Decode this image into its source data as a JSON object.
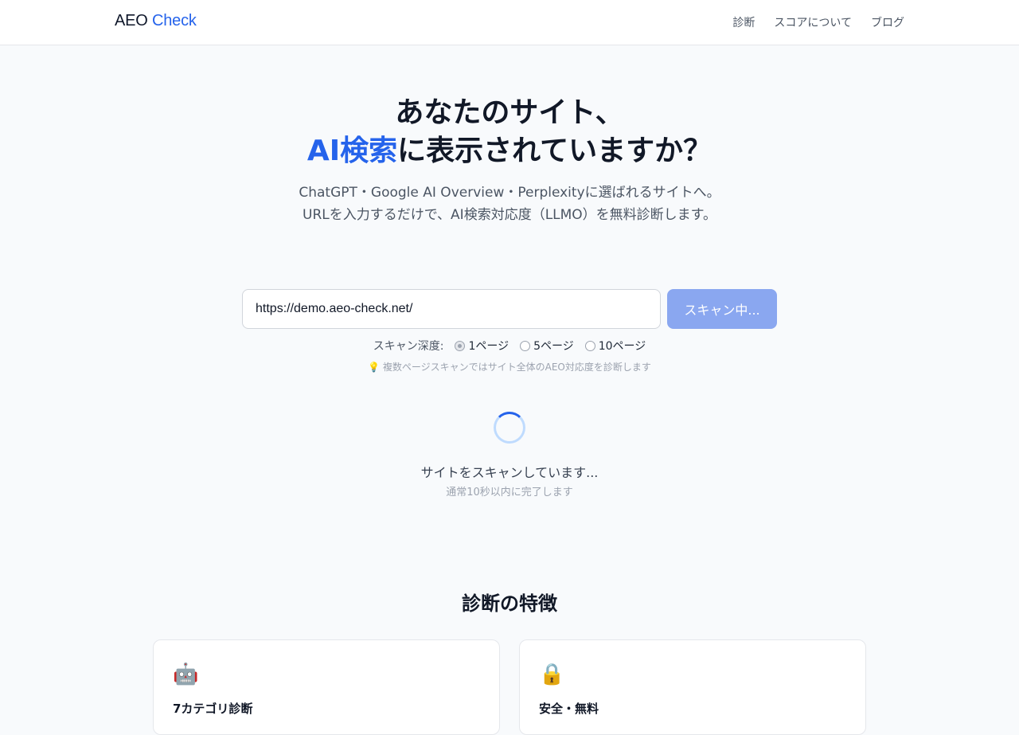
{
  "header": {
    "logo_part1": "AEO",
    "logo_part2": "Check",
    "nav": [
      "診断",
      "スコアについて",
      "ブログ"
    ]
  },
  "hero": {
    "title_line1": "あなたのサイト、",
    "title_accent": "AI検索",
    "title_line2_rest": "に表示されていますか？",
    "subtitle_line1": "ChatGPT・Google AI Overview・Perplexityに選ばれるサイトへ。",
    "subtitle_line2": "URLを入力するだけで、AI検索対応度（LLMO）を無料診断します。"
  },
  "scan_form": {
    "url_value": "https://demo.aeo-check.net/",
    "button_label": "スキャン中...",
    "depth_label": "スキャン深度:",
    "depth_options": [
      "1ページ",
      "5ページ",
      "10ページ"
    ],
    "depth_selected": "1ページ",
    "hint_icon": "lightbulb-icon",
    "hint_text": "💡 複数ページスキャンではサイト全体のAEO対応度を診断します"
  },
  "loading": {
    "text": "サイトをスキャンしています...",
    "subtext": "通常10秒以内に完了します"
  },
  "features": {
    "title": "診断の特徴",
    "cards": [
      {
        "icon": "robot-icon",
        "emoji": "🤖",
        "title": "7カテゴリ診断"
      },
      {
        "icon": "lock-icon",
        "emoji": "🔒",
        "title": "安全・無料"
      }
    ]
  },
  "colors": {
    "accent": "#2563eb",
    "button_disabled": "#8aa7f0",
    "background": "#f8fafc"
  }
}
